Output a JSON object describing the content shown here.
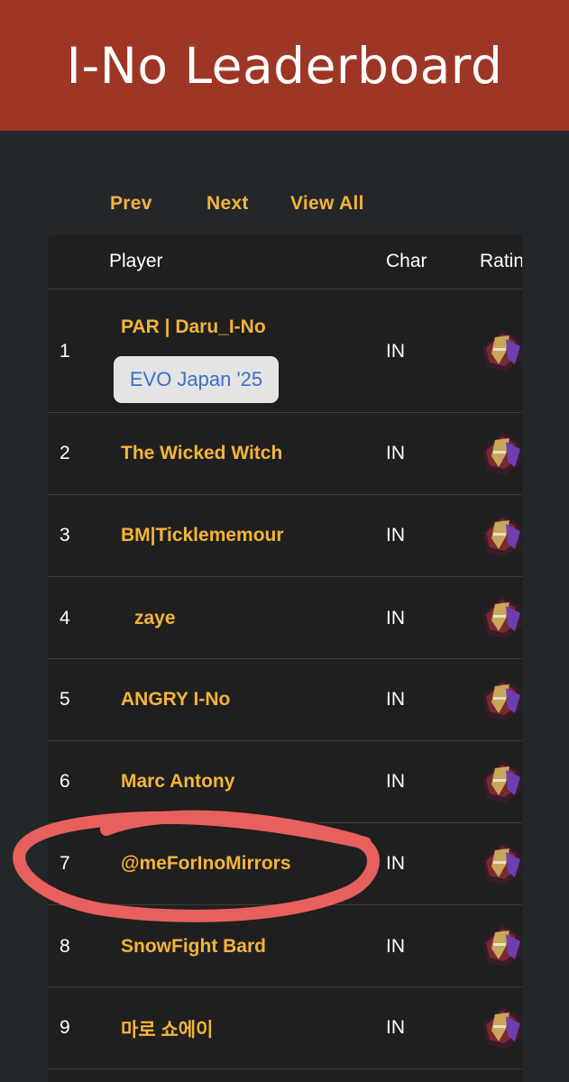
{
  "header": {
    "title": "I-No Leaderboard"
  },
  "nav": {
    "prev": "Prev",
    "next": "Next",
    "view_all": "View All"
  },
  "table": {
    "columns": {
      "player": "Player",
      "char": "Char",
      "rating": "Ratin"
    },
    "rows": [
      {
        "rank": "1",
        "name": "PAR | Daru_I-No",
        "char": "IN",
        "badge": "EVO Japan '25"
      },
      {
        "rank": "2",
        "name": "The Wicked Witch",
        "char": "IN"
      },
      {
        "rank": "3",
        "name": "BM|Ticklememour",
        "char": "IN"
      },
      {
        "rank": "4",
        "name": "zaye",
        "char": "IN"
      },
      {
        "rank": "5",
        "name": "ANGRY I-No",
        "char": "IN"
      },
      {
        "rank": "6",
        "name": "Marc Antony",
        "char": "IN"
      },
      {
        "rank": "7",
        "name": "@meForInoMirrors",
        "char": "IN"
      },
      {
        "rank": "8",
        "name": "SnowFight Bard",
        "char": "IN"
      },
      {
        "rank": "9",
        "name": "마로 쇼에이",
        "char": "IN"
      }
    ]
  },
  "colors": {
    "header_bg": "#9e3625",
    "page_bg": "#24272a",
    "table_bg": "#1f1f1f",
    "accent": "#f4b43a",
    "badge_text": "#3b6fc9",
    "highlight_stroke": "#e8605e"
  },
  "icons": {
    "rank_icon": "rank-emblem-icon"
  }
}
